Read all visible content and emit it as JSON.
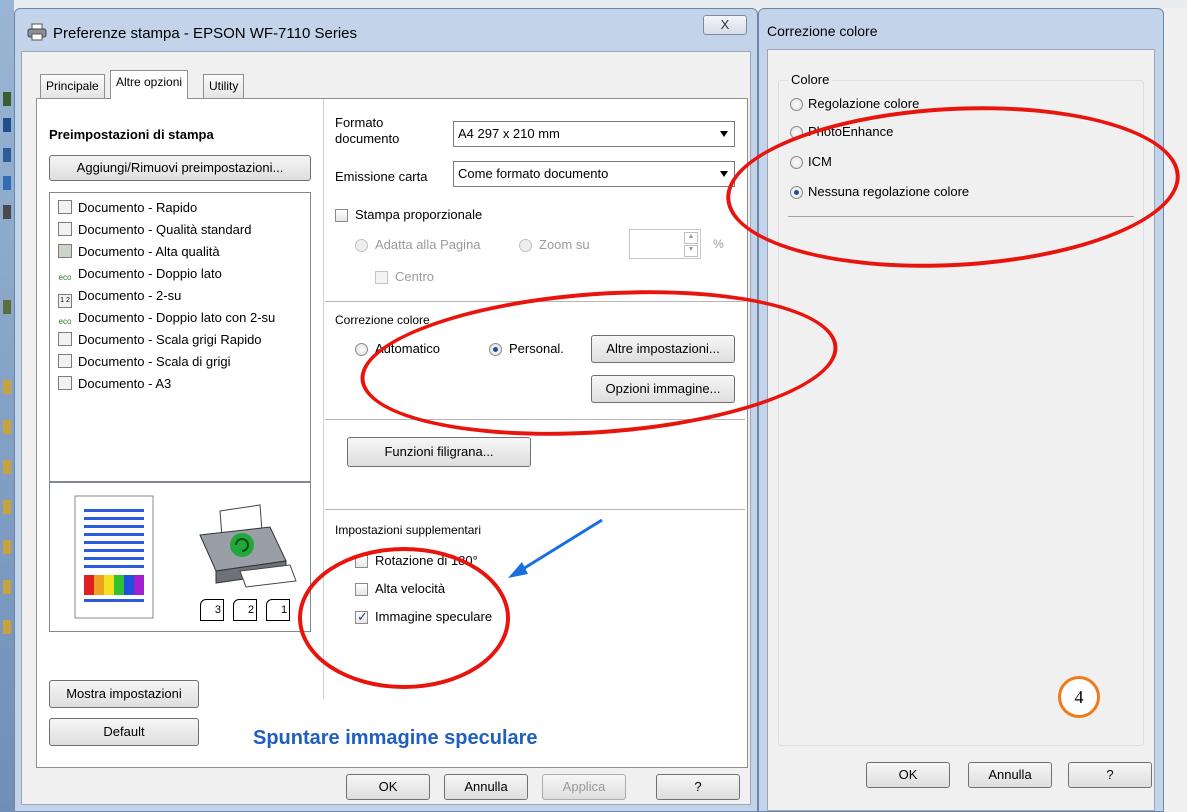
{
  "main_window": {
    "title": "Preferenze stampa - EPSON WF-7110 Series",
    "close_label": "X",
    "tabs": [
      {
        "label": "Principale"
      },
      {
        "label": "Altre opzioni"
      },
      {
        "label": "Utility"
      }
    ],
    "presets": {
      "heading": "Preimpostazioni di stampa",
      "add_remove_label": "Aggiungi/Rimuovi preimpostazioni...",
      "items": [
        {
          "label": "Documento - Rapido",
          "icon": "document-icon"
        },
        {
          "label": "Documento - Qualità standard",
          "icon": "document-icon"
        },
        {
          "label": "Documento - Alta qualità",
          "icon": "photo-document-icon"
        },
        {
          "label": "Documento - Doppio lato",
          "icon": "eco-icon"
        },
        {
          "label": "Documento - 2-su",
          "icon": "two-up-icon"
        },
        {
          "label": "Documento - Doppio lato con 2-su",
          "icon": "eco-icon"
        },
        {
          "label": "Documento - Scala grigi Rapido",
          "icon": "document-icon"
        },
        {
          "label": "Documento - Scala di grigi",
          "icon": "document-icon"
        },
        {
          "label": "Documento - A3",
          "icon": "document-icon"
        }
      ],
      "eco_text": "eco",
      "two_up_text": "1 2"
    },
    "collate_icons": [
      "3",
      "2",
      "1"
    ],
    "show_settings_label": "Mostra impostazioni",
    "default_label": "Default",
    "format_label": "Formato documento",
    "format_value": "A4 297 x 210 mm",
    "paper_output_label": "Emissione carta",
    "paper_output_value": "Come formato documento",
    "proportional_label": "Stampa proporzionale",
    "fit_page_label": "Adatta alla Pagina",
    "zoom_label": "Zoom su",
    "zoom_unit": "%",
    "center_label": "Centro",
    "color_correction_label": "Correzione colore",
    "automatic_label": "Automatico",
    "custom_label": "Personal.",
    "more_settings_label": "Altre impostazioni...",
    "image_options_label": "Opzioni immagine...",
    "watermark_label": "Funzioni filigrana...",
    "extra_settings_label": "Impostazioni supplementari",
    "rotate_label": "Rotazione di 180°",
    "high_speed_label": "Alta velocità",
    "mirror_label": "Immagine speculare",
    "instruction_text": "Spuntare immagine speculare",
    "ok_label": "OK",
    "cancel_label": "Annulla",
    "apply_label": "Applica",
    "help_label": "?"
  },
  "color_window": {
    "title": "Correzione colore",
    "group_label": "Colore",
    "options": [
      {
        "label": "Regolazione colore"
      },
      {
        "label": "PhotoEnhance"
      },
      {
        "label": "ICM"
      },
      {
        "label": "Nessuna regolazione colore"
      }
    ],
    "step_number": "4",
    "ok_label": "OK",
    "cancel_label": "Annulla",
    "help_label": "?"
  },
  "colors": {
    "annotation_red": "#e8150e",
    "annotation_blue": "#1a6fe0",
    "instruction_blue": "#1f5fbf",
    "step_orange": "#f07a1a"
  }
}
